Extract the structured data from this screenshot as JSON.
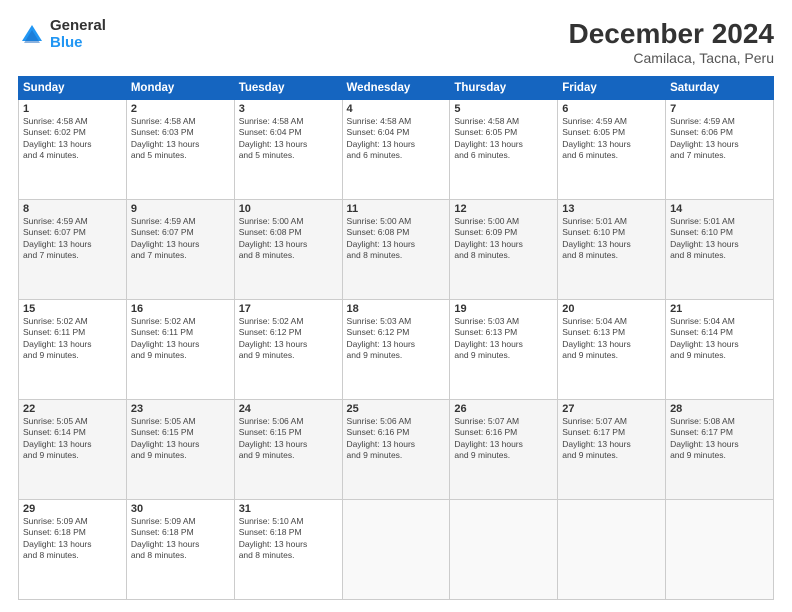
{
  "logo": {
    "general": "General",
    "blue": "Blue"
  },
  "header": {
    "title": "December 2024",
    "subtitle": "Camilaca, Tacna, Peru"
  },
  "weekdays": [
    "Sunday",
    "Monday",
    "Tuesday",
    "Wednesday",
    "Thursday",
    "Friday",
    "Saturday"
  ],
  "weeks": [
    [
      {
        "day": 1,
        "sunrise": "4:58 AM",
        "sunset": "6:02 PM",
        "daylight": "13 hours and 4 minutes."
      },
      {
        "day": 2,
        "sunrise": "4:58 AM",
        "sunset": "6:03 PM",
        "daylight": "13 hours and 5 minutes."
      },
      {
        "day": 3,
        "sunrise": "4:58 AM",
        "sunset": "6:04 PM",
        "daylight": "13 hours and 5 minutes."
      },
      {
        "day": 4,
        "sunrise": "4:58 AM",
        "sunset": "6:04 PM",
        "daylight": "13 hours and 6 minutes."
      },
      {
        "day": 5,
        "sunrise": "4:58 AM",
        "sunset": "6:05 PM",
        "daylight": "13 hours and 6 minutes."
      },
      {
        "day": 6,
        "sunrise": "4:59 AM",
        "sunset": "6:05 PM",
        "daylight": "13 hours and 6 minutes."
      },
      {
        "day": 7,
        "sunrise": "4:59 AM",
        "sunset": "6:06 PM",
        "daylight": "13 hours and 7 minutes."
      }
    ],
    [
      {
        "day": 8,
        "sunrise": "4:59 AM",
        "sunset": "6:07 PM",
        "daylight": "13 hours and 7 minutes."
      },
      {
        "day": 9,
        "sunrise": "4:59 AM",
        "sunset": "6:07 PM",
        "daylight": "13 hours and 7 minutes."
      },
      {
        "day": 10,
        "sunrise": "5:00 AM",
        "sunset": "6:08 PM",
        "daylight": "13 hours and 8 minutes."
      },
      {
        "day": 11,
        "sunrise": "5:00 AM",
        "sunset": "6:08 PM",
        "daylight": "13 hours and 8 minutes."
      },
      {
        "day": 12,
        "sunrise": "5:00 AM",
        "sunset": "6:09 PM",
        "daylight": "13 hours and 8 minutes."
      },
      {
        "day": 13,
        "sunrise": "5:01 AM",
        "sunset": "6:10 PM",
        "daylight": "13 hours and 8 minutes."
      },
      {
        "day": 14,
        "sunrise": "5:01 AM",
        "sunset": "6:10 PM",
        "daylight": "13 hours and 8 minutes."
      }
    ],
    [
      {
        "day": 15,
        "sunrise": "5:02 AM",
        "sunset": "6:11 PM",
        "daylight": "13 hours and 9 minutes."
      },
      {
        "day": 16,
        "sunrise": "5:02 AM",
        "sunset": "6:11 PM",
        "daylight": "13 hours and 9 minutes."
      },
      {
        "day": 17,
        "sunrise": "5:02 AM",
        "sunset": "6:12 PM",
        "daylight": "13 hours and 9 minutes."
      },
      {
        "day": 18,
        "sunrise": "5:03 AM",
        "sunset": "6:12 PM",
        "daylight": "13 hours and 9 minutes."
      },
      {
        "day": 19,
        "sunrise": "5:03 AM",
        "sunset": "6:13 PM",
        "daylight": "13 hours and 9 minutes."
      },
      {
        "day": 20,
        "sunrise": "5:04 AM",
        "sunset": "6:13 PM",
        "daylight": "13 hours and 9 minutes."
      },
      {
        "day": 21,
        "sunrise": "5:04 AM",
        "sunset": "6:14 PM",
        "daylight": "13 hours and 9 minutes."
      }
    ],
    [
      {
        "day": 22,
        "sunrise": "5:05 AM",
        "sunset": "6:14 PM",
        "daylight": "13 hours and 9 minutes."
      },
      {
        "day": 23,
        "sunrise": "5:05 AM",
        "sunset": "6:15 PM",
        "daylight": "13 hours and 9 minutes."
      },
      {
        "day": 24,
        "sunrise": "5:06 AM",
        "sunset": "6:15 PM",
        "daylight": "13 hours and 9 minutes."
      },
      {
        "day": 25,
        "sunrise": "5:06 AM",
        "sunset": "6:16 PM",
        "daylight": "13 hours and 9 minutes."
      },
      {
        "day": 26,
        "sunrise": "5:07 AM",
        "sunset": "6:16 PM",
        "daylight": "13 hours and 9 minutes."
      },
      {
        "day": 27,
        "sunrise": "5:07 AM",
        "sunset": "6:17 PM",
        "daylight": "13 hours and 9 minutes."
      },
      {
        "day": 28,
        "sunrise": "5:08 AM",
        "sunset": "6:17 PM",
        "daylight": "13 hours and 9 minutes."
      }
    ],
    [
      {
        "day": 29,
        "sunrise": "5:09 AM",
        "sunset": "6:18 PM",
        "daylight": "13 hours and 8 minutes."
      },
      {
        "day": 30,
        "sunrise": "5:09 AM",
        "sunset": "6:18 PM",
        "daylight": "13 hours and 8 minutes."
      },
      {
        "day": 31,
        "sunrise": "5:10 AM",
        "sunset": "6:18 PM",
        "daylight": "13 hours and 8 minutes."
      },
      null,
      null,
      null,
      null
    ]
  ]
}
